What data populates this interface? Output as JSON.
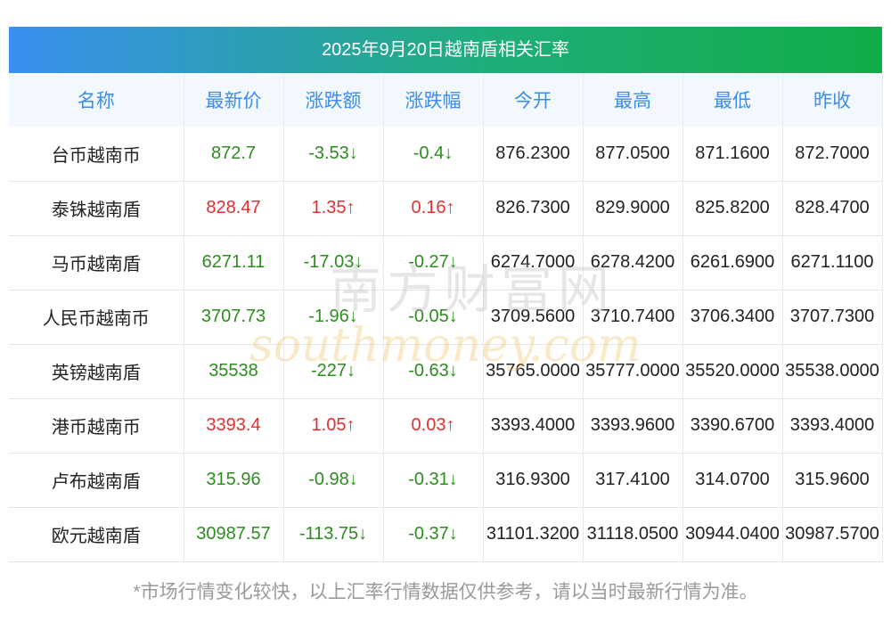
{
  "title": "2025年9月20日越南盾相关汇率",
  "headers": [
    "名称",
    "最新价",
    "涨跌额",
    "涨跌幅",
    "今开",
    "最高",
    "最低",
    "昨收"
  ],
  "rows": [
    {
      "name": "台币越南币",
      "latest": "872.7",
      "change": "-3.53↓",
      "pct": "-0.4↓",
      "open": "876.2300",
      "high": "877.0500",
      "low": "871.1600",
      "prev": "872.7000",
      "dir": "down"
    },
    {
      "name": "泰铢越南盾",
      "latest": "828.47",
      "change": "1.35↑",
      "pct": "0.16↑",
      "open": "826.7300",
      "high": "829.9000",
      "low": "825.8200",
      "prev": "828.4700",
      "dir": "up"
    },
    {
      "name": "马币越南盾",
      "latest": "6271.11",
      "change": "-17.03↓",
      "pct": "-0.27↓",
      "open": "6274.7000",
      "high": "6278.4200",
      "low": "6261.6900",
      "prev": "6271.1100",
      "dir": "down"
    },
    {
      "name": "人民币越南币",
      "latest": "3707.73",
      "change": "-1.96↓",
      "pct": "-0.05↓",
      "open": "3709.5600",
      "high": "3710.7400",
      "low": "3706.3400",
      "prev": "3707.7300",
      "dir": "down"
    },
    {
      "name": "英镑越南盾",
      "latest": "35538",
      "change": "-227↓",
      "pct": "-0.63↓",
      "open": "35765.0000",
      "high": "35777.0000",
      "low": "35520.0000",
      "prev": "35538.0000",
      "dir": "down"
    },
    {
      "name": "港币越南币",
      "latest": "3393.4",
      "change": "1.05↑",
      "pct": "0.03↑",
      "open": "3393.4000",
      "high": "3393.9600",
      "low": "3390.6700",
      "prev": "3393.4000",
      "dir": "up"
    },
    {
      "name": "卢布越南盾",
      "latest": "315.96",
      "change": "-0.98↓",
      "pct": "-0.31↓",
      "open": "316.9300",
      "high": "317.4100",
      "low": "314.0700",
      "prev": "315.9600",
      "dir": "down"
    },
    {
      "name": "欧元越南盾",
      "latest": "30987.57",
      "change": "-113.75↓",
      "pct": "-0.37↓",
      "open": "31101.3200",
      "high": "31118.0500",
      "low": "30944.0400",
      "prev": "30987.5700",
      "dir": "down"
    }
  ],
  "footnote": "*市场行情变化较快，以上汇率行情数据仅供参考，请以当时最新行情为准。",
  "watermark": {
    "cn": "南方财富网",
    "en": "southmoney.com"
  },
  "colors": {
    "up": "#e23030",
    "down": "#2e8b20",
    "header_text": "#3d8de9"
  }
}
